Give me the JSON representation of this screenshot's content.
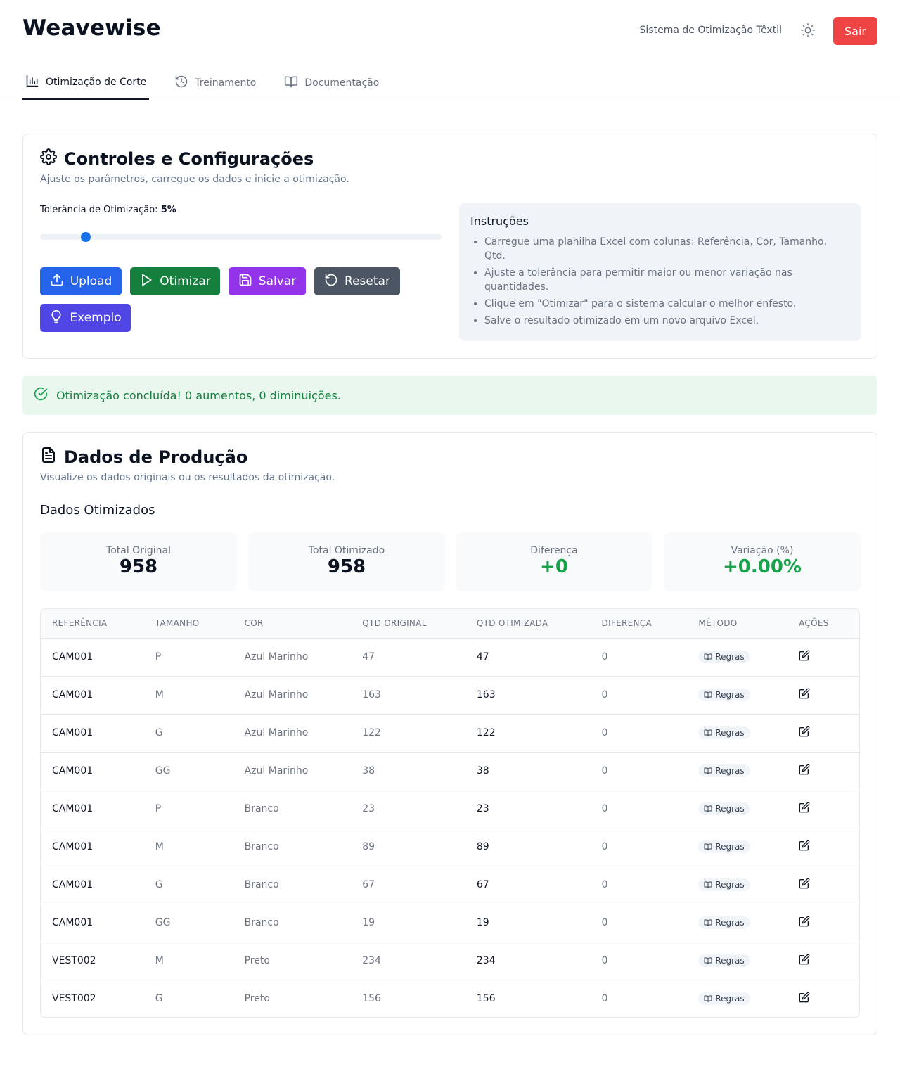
{
  "header": {
    "brand": "Weavewise",
    "system_title": "Sistema de Otimização Têxtil",
    "logout_label": "Sair"
  },
  "tabs": [
    {
      "label": "Otimização de Corte",
      "icon": "bar-chart-icon",
      "active": true
    },
    {
      "label": "Treinamento",
      "icon": "history-icon",
      "active": false
    },
    {
      "label": "Documentação",
      "icon": "book-open-icon",
      "active": false
    }
  ],
  "controls": {
    "title": "Controles e Configurações",
    "subtitle": "Ajuste os parâmetros, carregue os dados e inicie a otimização.",
    "tolerance_label": "Tolerância de Otimização:",
    "tolerance_value": "5%",
    "tolerance_fraction": 0.113,
    "buttons": {
      "upload": "Upload",
      "optimize": "Otimizar",
      "save": "Salvar",
      "reset": "Resetar",
      "example": "Exemplo"
    },
    "instructions": {
      "title": "Instruções",
      "items": [
        "Carregue uma planilha Excel com colunas: Referência, Cor, Tamanho, Qtd.",
        "Ajuste a tolerância para permitir maior ou menor variação nas quantidades.",
        "Clique em \"Otimizar\" para o sistema calcular o melhor enfesto.",
        "Salve o resultado otimizado em um novo arquivo Excel."
      ]
    }
  },
  "alert": {
    "message": "Otimização concluída! 0 aumentos, 0 diminuições."
  },
  "production": {
    "title": "Dados de Produção",
    "subtitle": "Visualize os dados originais ou os resultados da otimização.",
    "section_title": "Dados Otimizados",
    "stats": [
      {
        "label": "Total Original",
        "value": "958",
        "highlight": false
      },
      {
        "label": "Total Otimizado",
        "value": "958",
        "highlight": false
      },
      {
        "label": "Diferença",
        "value": "+0",
        "highlight": true
      },
      {
        "label": "Variação (%)",
        "value": "+0.00%",
        "highlight": true
      }
    ],
    "columns": [
      "REFERÊNCIA",
      "TAMANHO",
      "COR",
      "QTD ORIGINAL",
      "QTD OTIMIZADA",
      "DIFERENÇA",
      "MÉTODO",
      "AÇÕES"
    ],
    "rows": [
      {
        "ref": "CAM001",
        "size": "P",
        "color": "Azul Marinho",
        "orig": "47",
        "opt": "47",
        "diff": "0",
        "method": "Regras"
      },
      {
        "ref": "CAM001",
        "size": "M",
        "color": "Azul Marinho",
        "orig": "163",
        "opt": "163",
        "diff": "0",
        "method": "Regras"
      },
      {
        "ref": "CAM001",
        "size": "G",
        "color": "Azul Marinho",
        "orig": "122",
        "opt": "122",
        "diff": "0",
        "method": "Regras"
      },
      {
        "ref": "CAM001",
        "size": "GG",
        "color": "Azul Marinho",
        "orig": "38",
        "opt": "38",
        "diff": "0",
        "method": "Regras"
      },
      {
        "ref": "CAM001",
        "size": "P",
        "color": "Branco",
        "orig": "23",
        "opt": "23",
        "diff": "0",
        "method": "Regras"
      },
      {
        "ref": "CAM001",
        "size": "M",
        "color": "Branco",
        "orig": "89",
        "opt": "89",
        "diff": "0",
        "method": "Regras"
      },
      {
        "ref": "CAM001",
        "size": "G",
        "color": "Branco",
        "orig": "67",
        "opt": "67",
        "diff": "0",
        "method": "Regras"
      },
      {
        "ref": "CAM001",
        "size": "GG",
        "color": "Branco",
        "orig": "19",
        "opt": "19",
        "diff": "0",
        "method": "Regras"
      },
      {
        "ref": "VEST002",
        "size": "M",
        "color": "Preto",
        "orig": "234",
        "opt": "234",
        "diff": "0",
        "method": "Regras"
      },
      {
        "ref": "VEST002",
        "size": "G",
        "color": "Preto",
        "orig": "156",
        "opt": "156",
        "diff": "0",
        "method": "Regras"
      }
    ]
  },
  "colors": {
    "upload": "#2563eb",
    "optimize": "#15803d",
    "save": "#9333ea",
    "reset": "#4b5563",
    "example": "#4f46e5",
    "logout": "#ef4444",
    "success": "#16a34a"
  }
}
